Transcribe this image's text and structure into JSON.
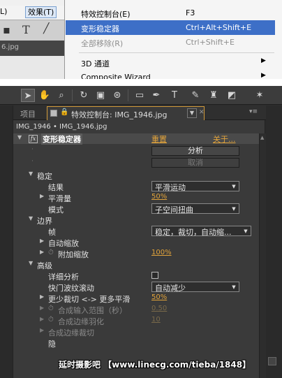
{
  "menubar": {
    "view_label": "L)",
    "effects_label": "效果(T)"
  },
  "left_panel": {
    "file_label": "6.jpg"
  },
  "menu": {
    "items": [
      {
        "label": "特效控制台(E)",
        "shortcut": "F3"
      },
      {
        "label": "变形稳定器",
        "shortcut": "Ctrl+Alt+Shift+E"
      },
      {
        "label": "全部移除(R)",
        "shortcut": "Ctrl+Shift+E"
      },
      {
        "label": "3D 通道",
        "shortcut": ""
      },
      {
        "label": "Composite Wizard",
        "shortcut": ""
      }
    ]
  },
  "panel": {
    "tab_project": "项目",
    "tab_effects": "特效控制台: IMG_1946.jpg",
    "breadcrumb": "IMG_1946 • IMG_1946.jpg"
  },
  "effect": {
    "fx_badge": "fx",
    "name": "变形稳定器",
    "reset": "重置",
    "about": "关于...",
    "analyze": "分析",
    "cancel": "取消",
    "stabilize": "稳定",
    "result_label": "结果",
    "result_value": "平滑运动",
    "smoothness_label": "平滑量",
    "smoothness_value": "50%",
    "method_label": "模式",
    "method_value": "子空间扭曲",
    "borders": "边界",
    "framing_label": "帧",
    "framing_value": "稳定，裁切，自动缩...",
    "autoscale_label": "自动缩放",
    "addscale_label": "附加缩放",
    "addscale_value": "100%",
    "advanced": "高级",
    "detailed_label": "详细分析",
    "rolling_label": "快门波纹滚动",
    "rolling_value": "自动减少",
    "crop_label": "更少裁切 <-> 更多平滑",
    "crop_value": "50%",
    "synth_range_label": "合成输入范围（秒）",
    "synth_range_value": "0.50",
    "synth_feather_label": "合成边缘羽化",
    "synth_feather_value": "10",
    "synth_crop_label": "合成边缘裁切",
    "hide_label": "隐"
  },
  "watermark": "延时摄影吧 【www.linecg.com/tieba/1848】",
  "colors": {
    "accent_orange": "#e1a33b",
    "menu_highlight": "#3d6fc7",
    "panel_bg": "#3a3a3a"
  }
}
